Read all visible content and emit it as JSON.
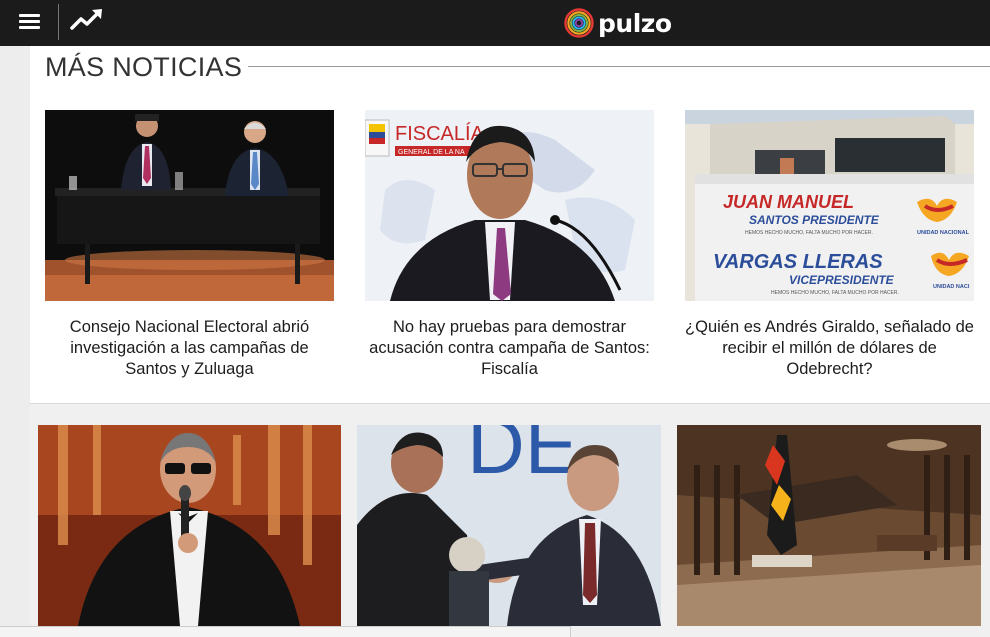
{
  "topbar": {
    "menu_icon": "hamburger-icon",
    "trending_icon": "trending-up-icon",
    "logo_text": "pulzo",
    "colors": {
      "background": "#1b1b1b",
      "text": "#ffffff"
    }
  },
  "mas_noticias": {
    "title": "MÁS NOTICIAS",
    "cards": [
      {
        "headline": "Consejo Nacional Electoral abrió investigación a las campañas de Santos y Zuluaga"
      },
      {
        "headline": "No hay pruebas para demostrar acusación contra campaña de Santos: Fiscalía",
        "image_text": "FISCALÍA",
        "image_subtext": "GENERAL DE LA NA"
      },
      {
        "headline": "¿Quién es Andrés Giraldo, señalado de recibir el millón de dólares de Odebrecht?",
        "image_text": {
          "line1": "JUAN MANUEL",
          "line2": "SANTOS PRESIDENTE",
          "line3": "HEMOS HECHO MUCHO, FALTA MUCHO POR HACER.",
          "line4": "VARGAS LLERAS",
          "line5": "VICEPRESIDENTE",
          "line6": "HEMOS HECHO MUCHO, FALTA MUCHO POR HACER.",
          "party": "UNIDAD NACIONAL",
          "party_cut": "UNIDAD NACI"
        }
      }
    ]
  },
  "second_row": {
    "images": [
      "jack-nicholson-photo",
      "handshake-photo",
      "hotel-lobby-photo"
    ],
    "image_text": "DE"
  }
}
